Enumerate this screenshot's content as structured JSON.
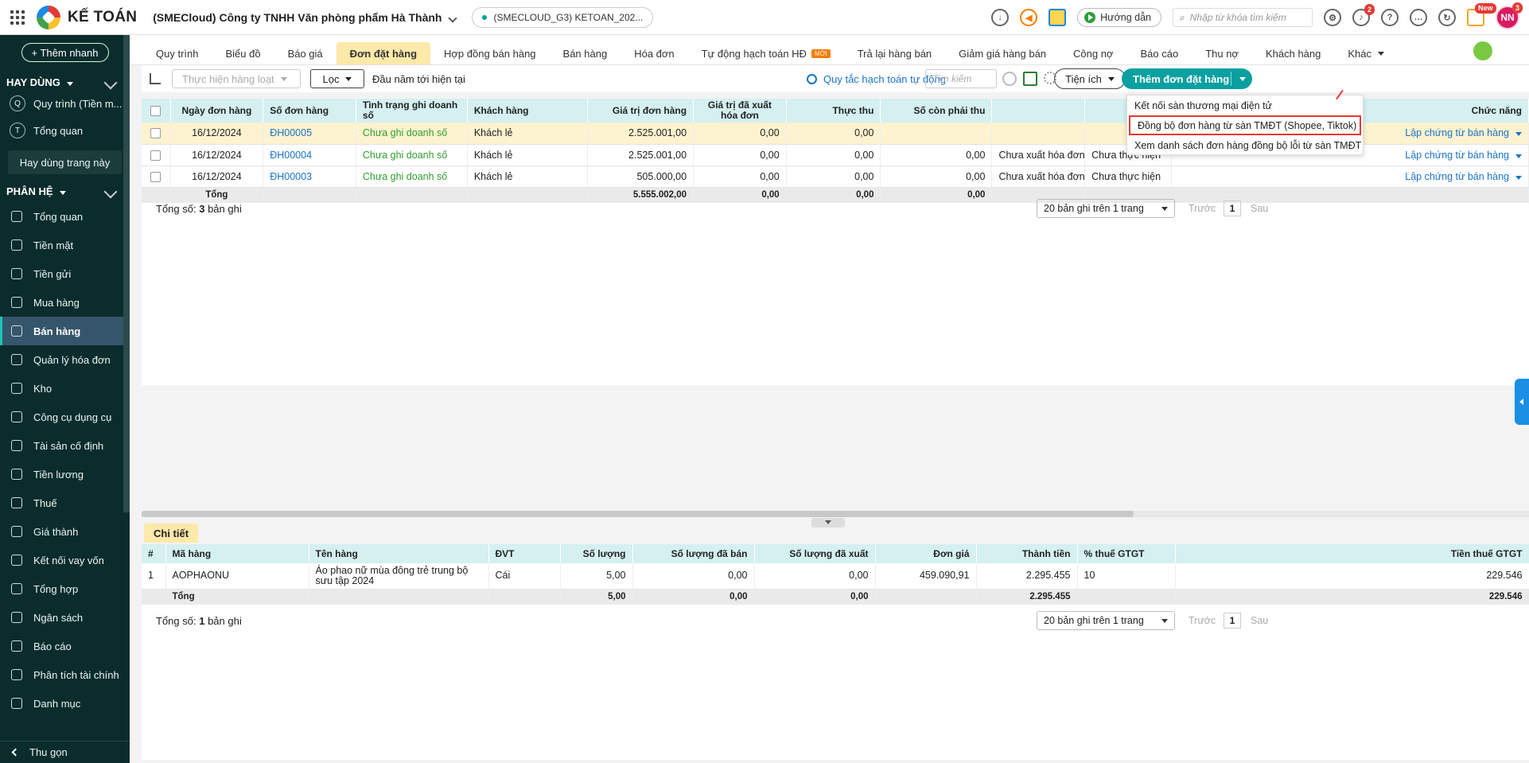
{
  "topbar": {
    "app_name": "KẾ TOÁN",
    "company": "(SMECloud) Công ty TNHH Văn phòng phẩm Hà Thành",
    "db": "(SMECLOUD_G3) KETOAN_202...",
    "guide": "Hướng dẫn",
    "search_placeholder": "Nhập từ khóa tìm kiếm",
    "notif_count": "2",
    "new_badge": "New",
    "avatar": "NN",
    "avatar_badge": "3"
  },
  "sidebar": {
    "quick_add": "+ Thêm nhanh",
    "fav_title": "HAY DÙNG",
    "favorites": [
      {
        "letter": "Q",
        "label": "Quy trình (Tiền m..."
      },
      {
        "letter": "T",
        "label": "Tổng quan"
      }
    ],
    "this_page": "Hay dùng trang này",
    "module_title": "PHÂN HỆ",
    "items": [
      "Tổng quan",
      "Tiền mặt",
      "Tiền gửi",
      "Mua hàng",
      "Bán hàng",
      "Quản lý hóa đơn",
      "Kho",
      "Công cụ dụng cụ",
      "Tài sản cố định",
      "Tiền lương",
      "Thuế",
      "Giá thành",
      "Kết nối vay vốn",
      "Tổng hợp",
      "Ngân sách",
      "Báo cáo",
      "Phân tích tài chính",
      "Danh mục"
    ],
    "collapse": "Thu gọn"
  },
  "tabs": {
    "items": [
      "Quy trình",
      "Biểu đồ",
      "Báo giá",
      "Đơn đặt hàng",
      "Hợp đồng bán hàng",
      "Bán hàng",
      "Hóa đơn",
      "Tự động hạch toán HĐ",
      "Trả lại hàng bán",
      "Giảm giá hàng bán",
      "Công nợ",
      "Báo cáo",
      "Thu nợ",
      "Khách hàng",
      "Khác"
    ],
    "new_tag": "MỚI"
  },
  "toolbar": {
    "bulk": "Thực hiện hàng loạt",
    "filter": "Lọc",
    "period": "Đầu năm tới hiện tại",
    "rule": "Quy tắc hạch toán tự động",
    "search_placeholder": "Tìm kiếm",
    "utility": "Tiện ích",
    "add_order": "Thêm đơn đặt hàng"
  },
  "dropdown": [
    "Kết nối sàn thương mại điện tử",
    "Đồng bộ đơn hàng từ sàn TMĐT (Shopee, Tiktok)",
    "Xem danh sách đơn hàng đồng bộ lỗi từ sàn TMĐT"
  ],
  "orders": {
    "columns": [
      "Ngày đơn hàng",
      "Số đơn hàng",
      "Tình trạng ghi doanh số",
      "Khách hàng",
      "Giá trị đơn hàng",
      "Giá trị đã xuất hóa đơn",
      "Thực thu",
      "Số còn phải thu",
      "",
      "",
      "Chức năng"
    ],
    "rows": [
      {
        "date": "16/12/2024",
        "no": "ĐH00005",
        "status": "Chưa ghi doanh số",
        "customer": "Khách lẻ",
        "value": "2.525.001,00",
        "invoiced": "0,00",
        "paid": "0,00",
        "remain": "",
        "inv_status": "",
        "exec": "",
        "action": "Lập chứng từ bán hàng"
      },
      {
        "date": "16/12/2024",
        "no": "ĐH00004",
        "status": "Chưa ghi doanh số",
        "customer": "Khách lẻ",
        "value": "2.525.001,00",
        "invoiced": "0,00",
        "paid": "0,00",
        "remain": "0,00",
        "inv_status": "Chưa xuất hóa đơn",
        "exec": "Chưa thực hiện",
        "action": "Lập chứng từ bán hàng"
      },
      {
        "date": "16/12/2024",
        "no": "ĐH00003",
        "status": "Chưa ghi doanh số",
        "customer": "Khách lẻ",
        "value": "505.000,00",
        "invoiced": "0,00",
        "paid": "0,00",
        "remain": "0,00",
        "inv_status": "Chưa xuất hóa đơn",
        "exec": "Chưa thực hiện",
        "action": "Lập chứng từ bán hàng"
      }
    ],
    "total_label": "Tổng",
    "total_value": "5.555.002,00",
    "total_invoiced": "0,00",
    "total_paid": "0,00",
    "total_remain": "0,00",
    "count_prefix": "Tổng số:",
    "count": "3",
    "count_suffix": "bản ghi"
  },
  "detail": {
    "tab": "Chi tiết",
    "columns": [
      "#",
      "Mã hàng",
      "Tên hàng",
      "ĐVT",
      "Số lượng",
      "Số lượng đã bán",
      "Số lượng đã xuất",
      "Đơn giá",
      "Thành tiền",
      "% thuế GTGT",
      "Tiền thuế GTGT"
    ],
    "rows": [
      {
        "idx": "1",
        "code": "AOPHAONU",
        "name": "Áo phao nữ mùa đông trẻ trung bộ sưu tập 2024",
        "unit": "Cái",
        "qty": "5,00",
        "sold": "0,00",
        "exported": "0,00",
        "price": "459.090,91",
        "amount": "2.295.455",
        "vat_pct": "10",
        "vat": "229.546"
      }
    ],
    "total_label": "Tổng",
    "total_qty": "5,00",
    "total_sold": "0,00",
    "total_exported": "0,00",
    "total_amount": "2.295.455",
    "total_vat": "229.546",
    "count_prefix": "Tổng số:",
    "count": "1",
    "count_suffix": "bản ghi"
  },
  "pager": {
    "size": "20 bản ghi trên 1 trang",
    "prev": "Trước",
    "page": "1",
    "next": "Sau"
  }
}
